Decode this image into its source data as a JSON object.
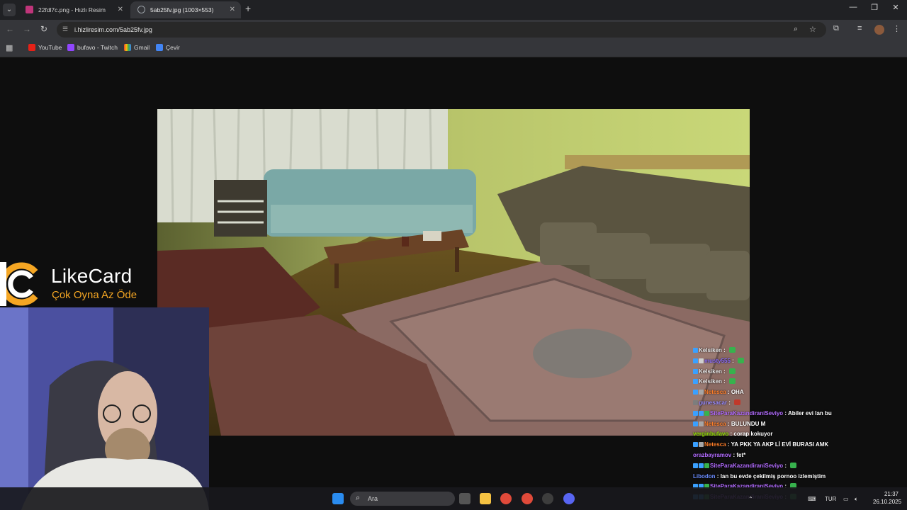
{
  "browser": {
    "tabs": [
      {
        "title": "22fdl7c.png - Hızlı Resim",
        "active": false
      },
      {
        "title": "5ab25fv.jpg (1003×553)",
        "active": true
      }
    ],
    "url": "i.hizliresim.com/5ab25fv.jpg",
    "bookmarks": [
      "YouTube",
      "bufavo - Twitch",
      "Gmail",
      "Çevir"
    ]
  },
  "overlay": {
    "brand": "LikeCard",
    "slogan": "Çok Oyna  Az Öde"
  },
  "chat": [
    {
      "user": "Kelsiken",
      "color": "#e8e8e8",
      "sep": ":",
      "text": "",
      "emote": "green",
      "badges": [
        "#3aa0ff"
      ]
    },
    {
      "user": "musty555",
      "color": "#8a6cff",
      "sep": ":",
      "text": "",
      "emote": "green",
      "badges": [
        "#3aa0ff",
        "#cfcfcf"
      ]
    },
    {
      "user": "Kelsiken",
      "color": "#e8e8e8",
      "sep": ":",
      "text": "",
      "emote": "green",
      "badges": [
        "#3aa0ff"
      ]
    },
    {
      "user": "Kelsiken",
      "color": "#e8e8e8",
      "sep": ":",
      "text": "",
      "emote": "green",
      "badges": [
        "#3aa0ff"
      ]
    },
    {
      "user": "Netesca",
      "color": "#ff7f2a",
      "sep": ":",
      "text": "OHA",
      "emote": "",
      "badges": [
        "#3aa0ff",
        "#a7a7a7"
      ]
    },
    {
      "user": "gunesacar",
      "color": "#9a8cff",
      "sep": ":",
      "text": "",
      "emote": "red",
      "badges": [
        "#7d7d7d"
      ]
    },
    {
      "user": "SiteParaKazandiraniSeviyo",
      "color": "#b26bff",
      "sep": ":",
      "text": "Abiler evi lan bu",
      "emote": "",
      "badges": [
        "#3aa0ff",
        "#3aa0ff",
        "#37b24d"
      ]
    },
    {
      "user": "Netesca",
      "color": "#ff7f2a",
      "sep": ":",
      "text": "BULUNDU M",
      "emote": "",
      "badges": [
        "#3aa0ff",
        "#a7a7a7"
      ]
    },
    {
      "user": "verginbufavo",
      "color": "#8ee000",
      "sep": ":",
      "text": "corap kokuyor",
      "emote": "",
      "badges": []
    },
    {
      "user": "Netesca",
      "color": "#ff7f2a",
      "sep": ":",
      "text": "YA PKK YA AKP Lİ EVİ BURASI AMK",
      "emote": "",
      "badges": [
        "#3aa0ff",
        "#a7a7a7"
      ]
    },
    {
      "user": "orazbayramov",
      "color": "#b26bff",
      "sep": ":",
      "text": "fet*",
      "emote": "",
      "badges": []
    },
    {
      "user": "SiteParaKazandiraniSeviyo",
      "color": "#b26bff",
      "sep": ":",
      "text": "",
      "emote": "green",
      "badges": [
        "#3aa0ff",
        "#3aa0ff",
        "#37b24d"
      ]
    },
    {
      "user": "Libodon",
      "color": "#6a8cff",
      "sep": ":",
      "text": "lan bu evde çekilmiş pornoo izlemiştim",
      "emote": "",
      "badges": []
    },
    {
      "user": "SiteParaKazandiraniSeviyo",
      "color": "#b26bff",
      "sep": ":",
      "text": "",
      "emote": "green",
      "badges": [
        "#3aa0ff",
        "#3aa0ff",
        "#37b24d"
      ]
    },
    {
      "user": "SiteParaKazandiraniSeviyo",
      "color": "#b26bff",
      "sep": ":",
      "text": "",
      "emote": "green",
      "badges": [
        "#3aa0ff",
        "#3aa0ff",
        "#37b24d"
      ]
    }
  ],
  "taskbar": {
    "search_placeholder": "Ara",
    "language": "TUR",
    "time": "21:37",
    "date": "26.10.2025"
  }
}
